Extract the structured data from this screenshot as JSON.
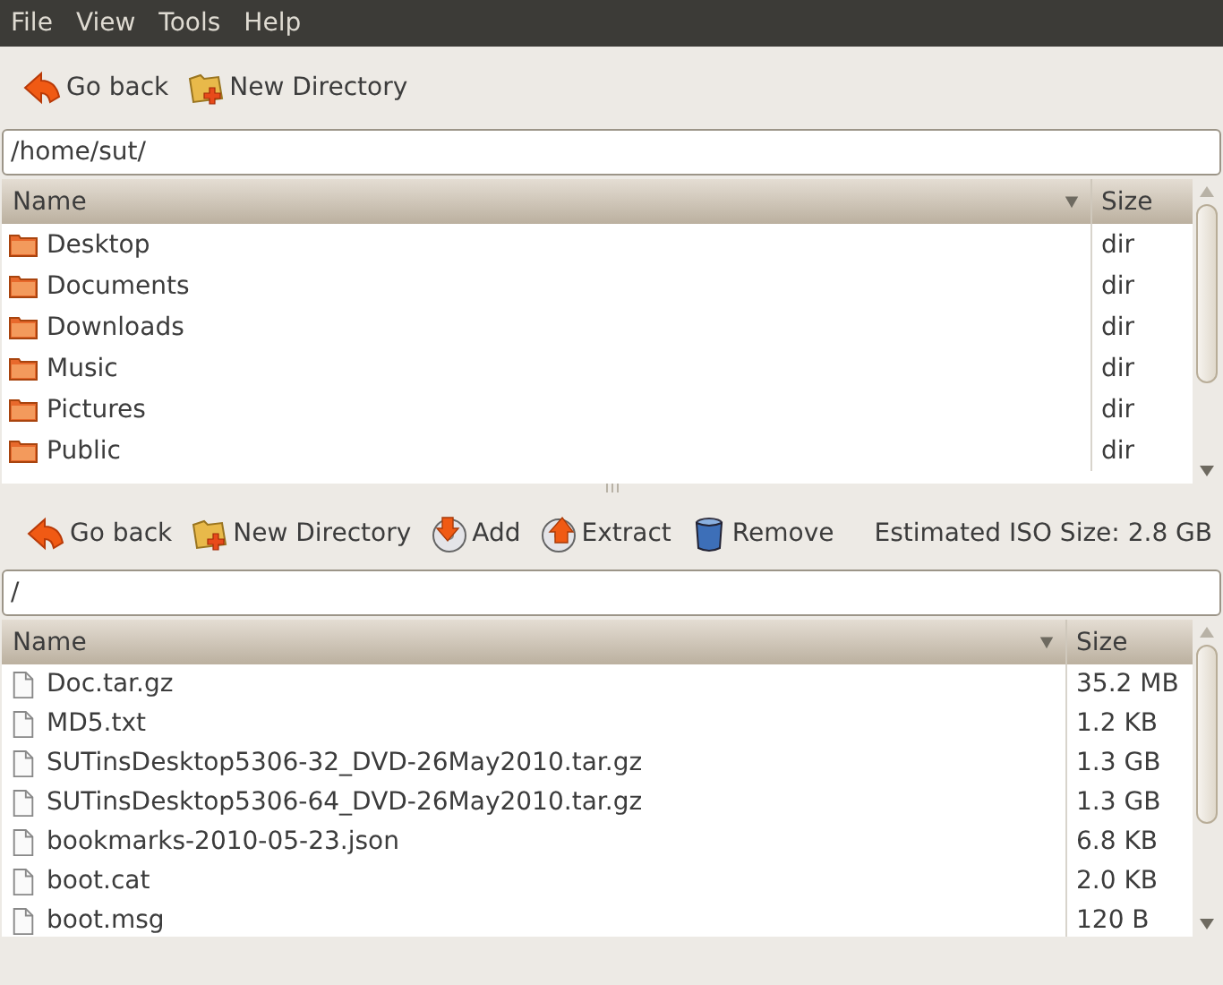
{
  "menu": [
    "File",
    "View",
    "Tools",
    "Help"
  ],
  "top_toolbar": [
    {
      "kind": "back",
      "label": "Go back"
    },
    {
      "kind": "newdir",
      "label": "New Directory"
    }
  ],
  "top_path": {
    "value": "/home/sut/"
  },
  "top_list": {
    "columns": [
      "Name",
      "Size"
    ],
    "rows": [
      {
        "kind": "folder",
        "name": "Desktop",
        "size": "dir"
      },
      {
        "kind": "folder",
        "name": "Documents",
        "size": "dir"
      },
      {
        "kind": "folder",
        "name": "Downloads",
        "size": "dir"
      },
      {
        "kind": "folder",
        "name": "Music",
        "size": "dir"
      },
      {
        "kind": "folder",
        "name": "Pictures",
        "size": "dir"
      },
      {
        "kind": "folder",
        "name": "Public",
        "size": "dir"
      }
    ]
  },
  "bottom_toolbar": [
    {
      "kind": "back",
      "label": "Go back"
    },
    {
      "kind": "newdir",
      "label": "New Directory"
    },
    {
      "kind": "add",
      "label": "Add"
    },
    {
      "kind": "extract",
      "label": "Extract"
    },
    {
      "kind": "remove",
      "label": "Remove"
    }
  ],
  "iso_size": "Estimated ISO Size: 2.8 GB",
  "bottom_path": {
    "value": "/"
  },
  "bottom_list": {
    "columns": [
      "Name",
      "Size"
    ],
    "rows": [
      {
        "kind": "file",
        "name": "Doc.tar.gz",
        "size": "35.2 MB"
      },
      {
        "kind": "file",
        "name": "MD5.txt",
        "size": "1.2 KB"
      },
      {
        "kind": "file",
        "name": "SUTinsDesktop5306-32_DVD-26May2010.tar.gz",
        "size": "1.3 GB"
      },
      {
        "kind": "file",
        "name": "SUTinsDesktop5306-64_DVD-26May2010.tar.gz",
        "size": "1.3 GB"
      },
      {
        "kind": "file",
        "name": "bookmarks-2010-05-23.json",
        "size": "6.8 KB"
      },
      {
        "kind": "file",
        "name": "boot.cat",
        "size": "2.0 KB"
      },
      {
        "kind": "file",
        "name": "boot.msg",
        "size": "120 B"
      }
    ]
  }
}
